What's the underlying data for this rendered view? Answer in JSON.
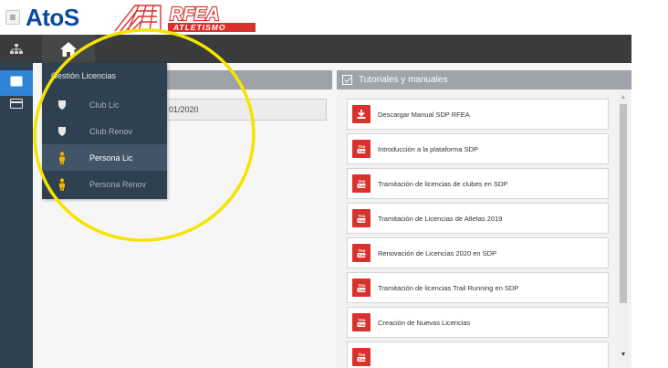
{
  "header": {
    "menu_icon": "hamburger-icon",
    "brand_text": "AtoS",
    "logo_text": "RFEA",
    "logo_subtext": "ATLETISMO",
    "logo_color": "#d9322e"
  },
  "nav": {
    "tree_icon": "sitemap-icon",
    "home_icon": "home-icon"
  },
  "rail": {
    "active_color": "#2f85d8",
    "items": [
      {
        "icon": "id-card-icon"
      },
      {
        "icon": "credit-card-icon"
      }
    ]
  },
  "flyout": {
    "title": "Gestión Licencias",
    "items": [
      {
        "label": "Club Lic",
        "icon": "shield-icon",
        "active": false
      },
      {
        "label": "Club Renov",
        "icon": "shield-icon",
        "active": false
      },
      {
        "label": "Persona Lic",
        "icon": "person-icon",
        "active": true
      },
      {
        "label": "Persona Renov",
        "icon": "person-icon",
        "active": false
      }
    ]
  },
  "left_panel": {
    "date_fragment": "01/2020"
  },
  "tutorials": {
    "title": "Tutoriales y manuales",
    "items": [
      {
        "label": "Descargar Manual SDP RFEA",
        "icon": "download-icon"
      },
      {
        "label": "Introducción a la plataforma SDP",
        "icon": "youtube-icon"
      },
      {
        "label": "Tramitación de licencias de clubes en SDP",
        "icon": "youtube-icon"
      },
      {
        "label": "Tramitación de Licencias de Atletas 2019",
        "icon": "youtube-icon"
      },
      {
        "label": "Renovación de Licencias 2020 en SDP",
        "icon": "youtube-icon"
      },
      {
        "label": "Tramitación de licencias Trail Running en SDP",
        "icon": "youtube-icon"
      },
      {
        "label": "Creación de Nuevas Licencias",
        "icon": "youtube-icon"
      },
      {
        "label": "",
        "icon": "youtube-icon"
      }
    ]
  },
  "annotation_color": "#f5e400"
}
